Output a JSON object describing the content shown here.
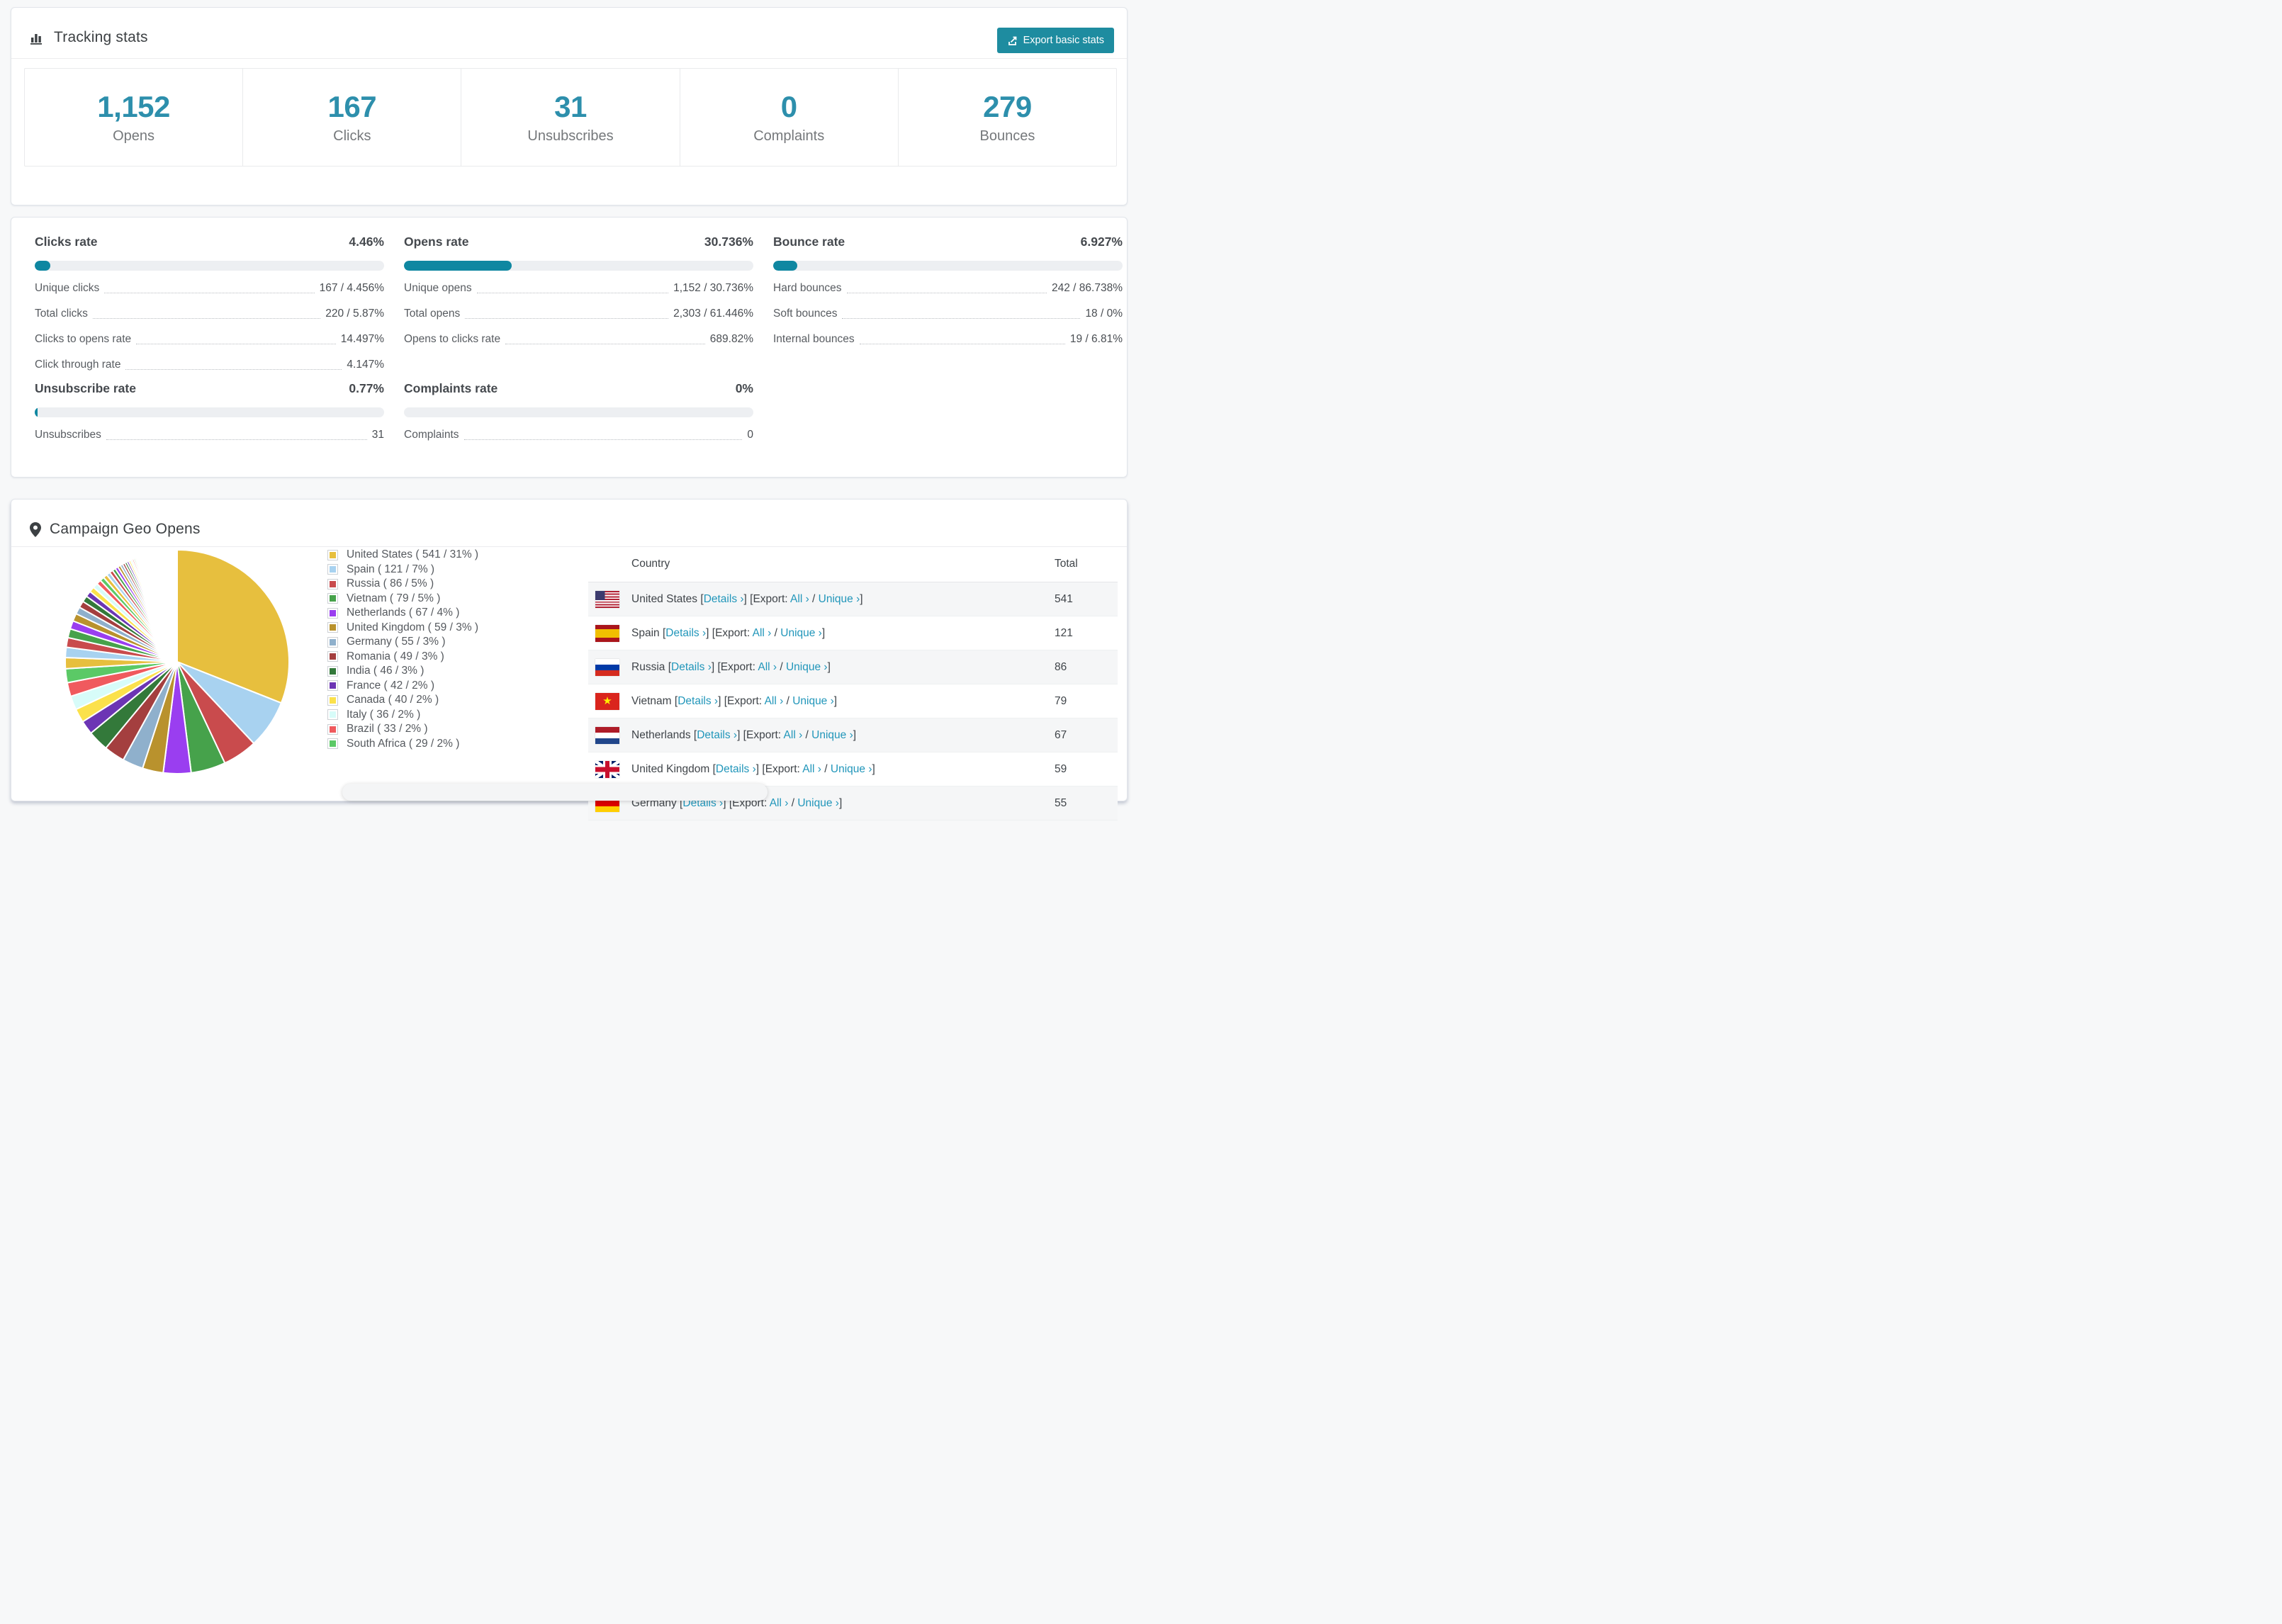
{
  "colors": {
    "accent_button": "#1e8ca0",
    "accent_bar": "#0f87a1",
    "link": "#2196ba",
    "stat_number": "#2d8fac",
    "page_bg": "#f7f8f9"
  },
  "tracking": {
    "title": "Tracking stats",
    "export_button_label": "Export basic stats",
    "stats": [
      {
        "value": "1,152",
        "label": "Opens"
      },
      {
        "value": "167",
        "label": "Clicks"
      },
      {
        "value": "31",
        "label": "Unsubscribes"
      },
      {
        "value": "0",
        "label": "Complaints"
      },
      {
        "value": "279",
        "label": "Bounces"
      }
    ]
  },
  "rates": [
    {
      "id": "clicks",
      "title": "Clicks rate",
      "pct_label": "4.46%",
      "bar_pct": 4.46,
      "rows": [
        [
          "Unique clicks",
          "167 / 4.456%"
        ],
        [
          "Total clicks",
          "220 / 5.87%"
        ],
        [
          "Clicks to opens rate",
          "14.497%"
        ],
        [
          "Click through rate",
          "4.147%"
        ]
      ]
    },
    {
      "id": "opens",
      "title": "Opens rate",
      "pct_label": "30.736%",
      "bar_pct": 30.736,
      "rows": [
        [
          "Unique opens",
          "1,152 / 30.736%"
        ],
        [
          "Total opens",
          "2,303 / 61.446%"
        ],
        [
          "Opens to clicks rate",
          "689.82%"
        ]
      ]
    },
    {
      "id": "bounce",
      "title": "Bounce rate",
      "pct_label": "6.927%",
      "bar_pct": 6.927,
      "rows": [
        [
          "Hard bounces",
          "242 / 86.738%"
        ],
        [
          "Soft bounces",
          "18 / 0%"
        ],
        [
          "Internal bounces",
          "19 / 6.81%"
        ]
      ]
    },
    {
      "id": "unsubscribe",
      "title": "Unsubscribe rate",
      "pct_label": "0.77%",
      "bar_pct": 0.77,
      "rows": [
        [
          "Unsubscribes",
          "31"
        ]
      ]
    },
    {
      "id": "complaints",
      "title": "Complaints rate",
      "pct_label": "0%",
      "bar_pct": 0,
      "rows": [
        [
          "Complaints",
          "0"
        ]
      ]
    }
  ],
  "geo": {
    "title": "Campaign Geo Opens",
    "legend_format": "name ( value / pct% )",
    "table": {
      "headers": [
        "Country",
        "Total"
      ],
      "link_labels": {
        "details": "Details ›",
        "export": "Export:",
        "all": "All ›",
        "unique": "Unique ›"
      },
      "rows": [
        {
          "country": "United States",
          "flag": "us",
          "total": "541"
        },
        {
          "country": "Spain",
          "flag": "es",
          "total": "121"
        },
        {
          "country": "Russia",
          "flag": "ru",
          "total": "86"
        },
        {
          "country": "Vietnam",
          "flag": "vn",
          "total": "79"
        },
        {
          "country": "Netherlands",
          "flag": "nl",
          "total": "67"
        },
        {
          "country": "United Kingdom",
          "flag": "gb",
          "total": "59"
        },
        {
          "country": "Germany",
          "flag": "de",
          "total": "55"
        }
      ]
    }
  },
  "chart_data": {
    "type": "pie",
    "title": "Campaign Geo Opens",
    "unit": "opens",
    "start": "top",
    "direction": "clockwise",
    "legend_position": "right-of-chart",
    "series": [
      {
        "name": "United States",
        "value": 541,
        "pct": 31,
        "color": "#e7bf3e"
      },
      {
        "name": "Spain",
        "value": 121,
        "pct": 7,
        "color": "#a8d2f0"
      },
      {
        "name": "Russia",
        "value": 86,
        "pct": 5,
        "color": "#c94b4d"
      },
      {
        "name": "Vietnam",
        "value": 79,
        "pct": 5,
        "color": "#46a24b"
      },
      {
        "name": "Netherlands",
        "value": 67,
        "pct": 4,
        "color": "#9a3ef0"
      },
      {
        "name": "United Kingdom",
        "value": 59,
        "pct": 3,
        "color": "#b9922d"
      },
      {
        "name": "Germany",
        "value": 55,
        "pct": 3,
        "color": "#8fb0cc"
      },
      {
        "name": "Romania",
        "value": 49,
        "pct": 3,
        "color": "#a43f3f"
      },
      {
        "name": "India",
        "value": 46,
        "pct": 3,
        "color": "#33793a"
      },
      {
        "name": "France",
        "value": 42,
        "pct": 2,
        "color": "#6c35b4"
      },
      {
        "name": "Canada",
        "value": 40,
        "pct": 2,
        "color": "#fbe14b"
      },
      {
        "name": "Italy",
        "value": 36,
        "pct": 2,
        "color": "#d7fcf9"
      },
      {
        "name": "Brazil",
        "value": 33,
        "pct": 2,
        "color": "#f05a5e"
      },
      {
        "name": "South Africa",
        "value": 29,
        "pct": 2,
        "color": "#5bc966"
      }
    ],
    "others": {
      "note": "long tail of small unlabeled countries",
      "first_pct": 1.6,
      "decay": 0.93,
      "count": 48
    }
  }
}
